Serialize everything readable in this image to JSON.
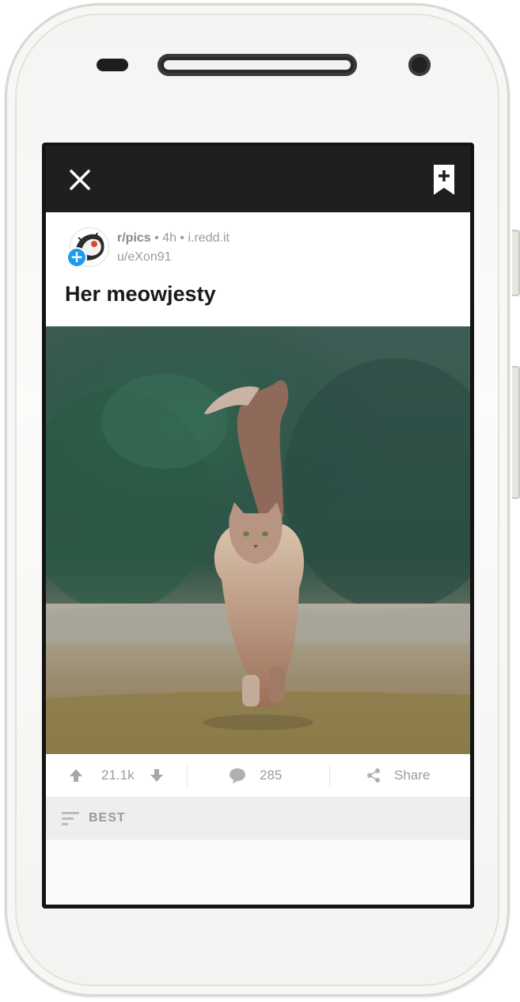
{
  "toolbar": {
    "close_icon": "close-icon",
    "save_icon": "bookmark-plus-icon"
  },
  "post": {
    "subreddit": "r/pics",
    "meta_rest": " • 4h • i.redd.it",
    "author": "u/eXon91",
    "title": "Her meowjesty",
    "image_alt": "A long-haired cat walking toward the camera with its tail raised, in front of dark green foliage"
  },
  "actions": {
    "upvotes": "21.1k",
    "comments": "285",
    "share_label": "Share"
  },
  "sort": {
    "label": "BEST"
  },
  "colors": {
    "topbar": "#1f1f1f",
    "badge": "#1e9bf0",
    "muted_text": "#9b9b9b"
  }
}
